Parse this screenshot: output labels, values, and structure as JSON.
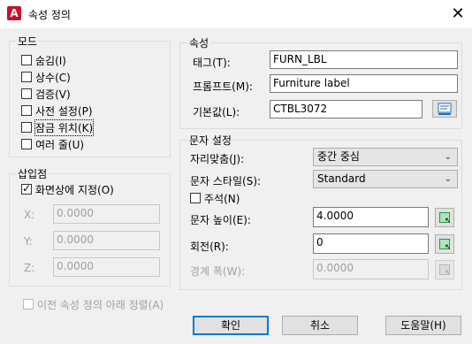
{
  "window": {
    "title": "속성 정의",
    "app_icon": "A",
    "close_glyph": "✕"
  },
  "mode": {
    "label": "모드",
    "items": [
      {
        "label": "숨김(I)",
        "checked": false
      },
      {
        "label": "상수(C)",
        "checked": false
      },
      {
        "label": "검증(V)",
        "checked": false
      },
      {
        "label": "사전 설정(P)",
        "checked": false
      },
      {
        "label": "잠금 위치(K)",
        "checked": false
      },
      {
        "label": "여러 줄(U)",
        "checked": false
      }
    ]
  },
  "insertion": {
    "label": "삽입점",
    "specify_on_screen": "화면상에 지정(O)",
    "specify_checked": true,
    "x_label": "X:",
    "x_value": "0.0000",
    "y_label": "Y:",
    "y_value": "0.0000",
    "z_label": "Z:",
    "z_value": "0.0000"
  },
  "attribute": {
    "label": "속성",
    "tag_label": "태그(T):",
    "tag_value": "FURN_LBL",
    "prompt_label": "프롬프트(M):",
    "prompt_value": "Furniture label",
    "default_label": "기본값(L):",
    "default_value": "CTBL3072"
  },
  "text_settings": {
    "label": "문자 설정",
    "justification_label": "자리맞춤(J):",
    "justification_value": "중간 중심",
    "style_label": "문자 스타일(S):",
    "style_value": "Standard",
    "annotative_label": "주석(N)",
    "annotative_checked": false,
    "height_label": "문자 높이(E):",
    "height_value": "4.0000",
    "rotation_label": "회전(R):",
    "rotation_value": "0",
    "boundary_label": "경계 폭(W):",
    "boundary_value": "0.0000"
  },
  "align_below": "이전 속성 정의 아래 정렬(A)",
  "buttons": {
    "ok": "확인",
    "cancel": "취소",
    "help": "도움말(H)"
  },
  "icons": {
    "chevron": "⌄",
    "pick_arrow": "↖"
  }
}
